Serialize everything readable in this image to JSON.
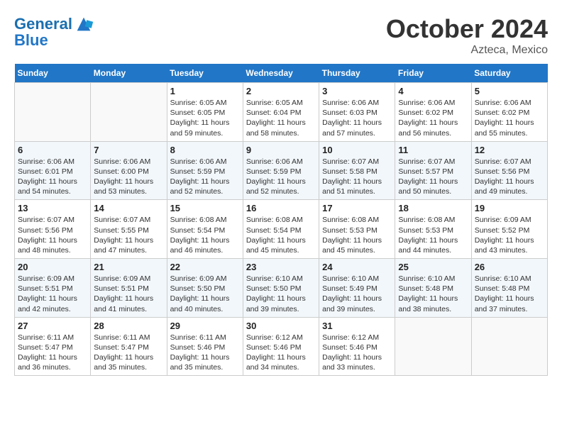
{
  "header": {
    "logo_line1": "General",
    "logo_line2": "Blue",
    "month_title": "October 2024",
    "location": "Azteca, Mexico"
  },
  "weekdays": [
    "Sunday",
    "Monday",
    "Tuesday",
    "Wednesday",
    "Thursday",
    "Friday",
    "Saturday"
  ],
  "weeks": [
    [
      {
        "day": "",
        "info": ""
      },
      {
        "day": "",
        "info": ""
      },
      {
        "day": "1",
        "info": "Sunrise: 6:05 AM\nSunset: 6:05 PM\nDaylight: 11 hours and 59 minutes."
      },
      {
        "day": "2",
        "info": "Sunrise: 6:05 AM\nSunset: 6:04 PM\nDaylight: 11 hours and 58 minutes."
      },
      {
        "day": "3",
        "info": "Sunrise: 6:06 AM\nSunset: 6:03 PM\nDaylight: 11 hours and 57 minutes."
      },
      {
        "day": "4",
        "info": "Sunrise: 6:06 AM\nSunset: 6:02 PM\nDaylight: 11 hours and 56 minutes."
      },
      {
        "day": "5",
        "info": "Sunrise: 6:06 AM\nSunset: 6:02 PM\nDaylight: 11 hours and 55 minutes."
      }
    ],
    [
      {
        "day": "6",
        "info": "Sunrise: 6:06 AM\nSunset: 6:01 PM\nDaylight: 11 hours and 54 minutes."
      },
      {
        "day": "7",
        "info": "Sunrise: 6:06 AM\nSunset: 6:00 PM\nDaylight: 11 hours and 53 minutes."
      },
      {
        "day": "8",
        "info": "Sunrise: 6:06 AM\nSunset: 5:59 PM\nDaylight: 11 hours and 52 minutes."
      },
      {
        "day": "9",
        "info": "Sunrise: 6:06 AM\nSunset: 5:59 PM\nDaylight: 11 hours and 52 minutes."
      },
      {
        "day": "10",
        "info": "Sunrise: 6:07 AM\nSunset: 5:58 PM\nDaylight: 11 hours and 51 minutes."
      },
      {
        "day": "11",
        "info": "Sunrise: 6:07 AM\nSunset: 5:57 PM\nDaylight: 11 hours and 50 minutes."
      },
      {
        "day": "12",
        "info": "Sunrise: 6:07 AM\nSunset: 5:56 PM\nDaylight: 11 hours and 49 minutes."
      }
    ],
    [
      {
        "day": "13",
        "info": "Sunrise: 6:07 AM\nSunset: 5:56 PM\nDaylight: 11 hours and 48 minutes."
      },
      {
        "day": "14",
        "info": "Sunrise: 6:07 AM\nSunset: 5:55 PM\nDaylight: 11 hours and 47 minutes."
      },
      {
        "day": "15",
        "info": "Sunrise: 6:08 AM\nSunset: 5:54 PM\nDaylight: 11 hours and 46 minutes."
      },
      {
        "day": "16",
        "info": "Sunrise: 6:08 AM\nSunset: 5:54 PM\nDaylight: 11 hours and 45 minutes."
      },
      {
        "day": "17",
        "info": "Sunrise: 6:08 AM\nSunset: 5:53 PM\nDaylight: 11 hours and 45 minutes."
      },
      {
        "day": "18",
        "info": "Sunrise: 6:08 AM\nSunset: 5:53 PM\nDaylight: 11 hours and 44 minutes."
      },
      {
        "day": "19",
        "info": "Sunrise: 6:09 AM\nSunset: 5:52 PM\nDaylight: 11 hours and 43 minutes."
      }
    ],
    [
      {
        "day": "20",
        "info": "Sunrise: 6:09 AM\nSunset: 5:51 PM\nDaylight: 11 hours and 42 minutes."
      },
      {
        "day": "21",
        "info": "Sunrise: 6:09 AM\nSunset: 5:51 PM\nDaylight: 11 hours and 41 minutes."
      },
      {
        "day": "22",
        "info": "Sunrise: 6:09 AM\nSunset: 5:50 PM\nDaylight: 11 hours and 40 minutes."
      },
      {
        "day": "23",
        "info": "Sunrise: 6:10 AM\nSunset: 5:50 PM\nDaylight: 11 hours and 39 minutes."
      },
      {
        "day": "24",
        "info": "Sunrise: 6:10 AM\nSunset: 5:49 PM\nDaylight: 11 hours and 39 minutes."
      },
      {
        "day": "25",
        "info": "Sunrise: 6:10 AM\nSunset: 5:48 PM\nDaylight: 11 hours and 38 minutes."
      },
      {
        "day": "26",
        "info": "Sunrise: 6:10 AM\nSunset: 5:48 PM\nDaylight: 11 hours and 37 minutes."
      }
    ],
    [
      {
        "day": "27",
        "info": "Sunrise: 6:11 AM\nSunset: 5:47 PM\nDaylight: 11 hours and 36 minutes."
      },
      {
        "day": "28",
        "info": "Sunrise: 6:11 AM\nSunset: 5:47 PM\nDaylight: 11 hours and 35 minutes."
      },
      {
        "day": "29",
        "info": "Sunrise: 6:11 AM\nSunset: 5:46 PM\nDaylight: 11 hours and 35 minutes."
      },
      {
        "day": "30",
        "info": "Sunrise: 6:12 AM\nSunset: 5:46 PM\nDaylight: 11 hours and 34 minutes."
      },
      {
        "day": "31",
        "info": "Sunrise: 6:12 AM\nSunset: 5:46 PM\nDaylight: 11 hours and 33 minutes."
      },
      {
        "day": "",
        "info": ""
      },
      {
        "day": "",
        "info": ""
      }
    ]
  ]
}
